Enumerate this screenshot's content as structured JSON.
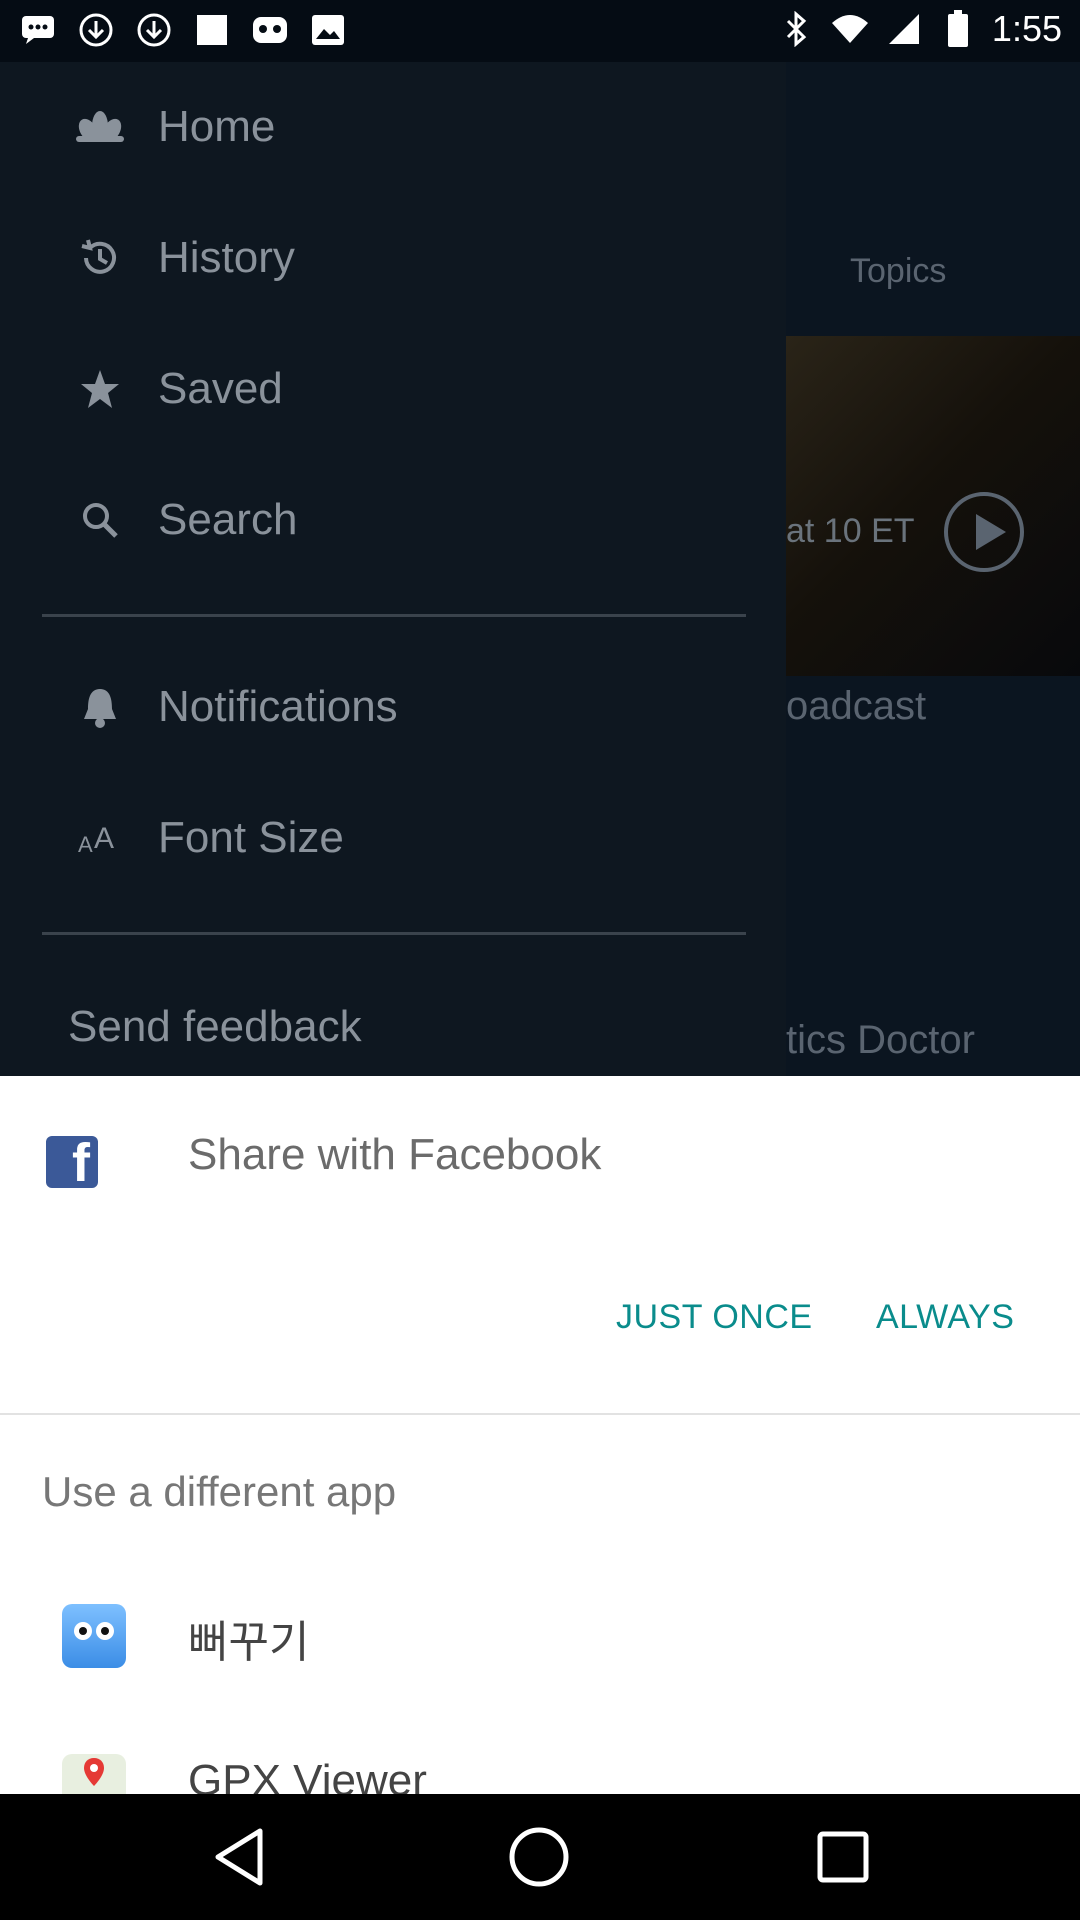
{
  "status_bar": {
    "time": "1:55",
    "left_icons": [
      "chat-icon",
      "download-icon",
      "download-icon",
      "image-icon",
      "game-icon",
      "gallery-icon"
    ],
    "right_icons": [
      "bluetooth-icon",
      "wifi-icon",
      "signal-icon",
      "battery-icon"
    ]
  },
  "background": {
    "topics": "Topics",
    "live_text": "at 10 ET",
    "broadcast_text": "oadcast",
    "doctor_text": "tics Doctor"
  },
  "drawer": {
    "items": [
      {
        "label": "Home",
        "icon": "lotus-icon"
      },
      {
        "label": "History",
        "icon": "history-icon"
      },
      {
        "label": "Saved",
        "icon": "star-icon"
      },
      {
        "label": "Search",
        "icon": "search-icon"
      },
      {
        "label": "Notifications",
        "icon": "bell-icon"
      },
      {
        "label": "Font Size",
        "icon": "font-size-icon"
      }
    ],
    "feedback": "Send feedback"
  },
  "sheet": {
    "title": "Share with Facebook",
    "just_once": "JUST ONCE",
    "always": "ALWAYS",
    "different_app": "Use a different app",
    "apps": [
      {
        "label": "뻐꾸기",
        "icon": "bird-face-icon"
      },
      {
        "label": "GPX Viewer",
        "icon": "map-pin-icon"
      }
    ]
  },
  "colors": {
    "accent": "#0a8c8c",
    "facebook": "#3b5998",
    "drawer_text": "#8a929b"
  }
}
